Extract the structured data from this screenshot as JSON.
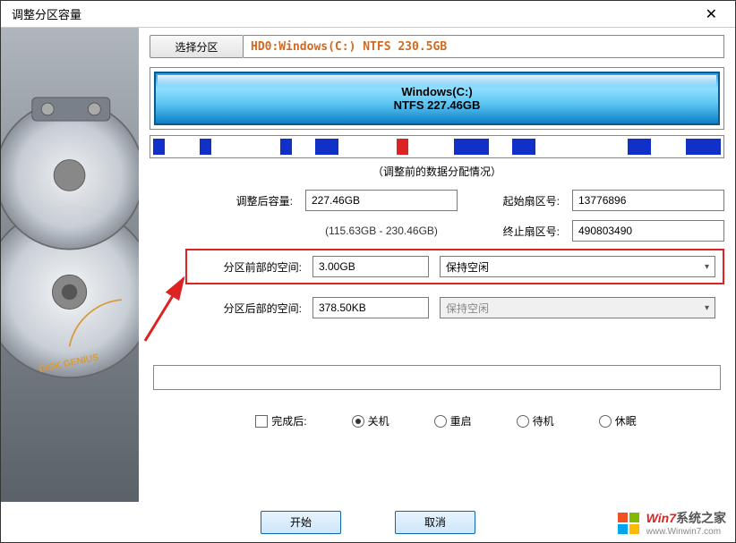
{
  "titlebar": {
    "title": "调整分区容量"
  },
  "selectPartition": {
    "button": "选择分区",
    "desc": "HD0:Windows(C:) NTFS 230.5GB"
  },
  "partitionBox": {
    "line1": "Windows(C:)",
    "line2": "NTFS 227.46GB"
  },
  "dataInfoLabel": "（调整前的数据分配情况）",
  "form": {
    "sizeAfterLabel": "调整后容量:",
    "sizeAfterValue": "227.46GB",
    "sizeRange": "(115.63GB - 230.46GB)",
    "startSectorLabel": "起始扇区号:",
    "startSectorValue": "13776896",
    "endSectorLabel": "终止扇区号:",
    "endSectorValue": "490803490",
    "frontSpaceLabel": "分区前部的空间:",
    "frontSpaceValue": "3.00GB",
    "frontSpaceAction": "保持空闲",
    "backSpaceLabel": "分区后部的空间:",
    "backSpaceValue": "378.50KB",
    "backSpaceAction": "保持空闲"
  },
  "afterAction": {
    "checkboxLabel": "完成后:",
    "opt1": "关机",
    "opt2": "重启",
    "opt3": "待机",
    "opt4": "休眠"
  },
  "footer": {
    "start": "开始",
    "cancel": "取消"
  },
  "watermark": {
    "brand1": "Win7",
    "brand2": "系统之家",
    "url": "www.Winwin7.com"
  }
}
